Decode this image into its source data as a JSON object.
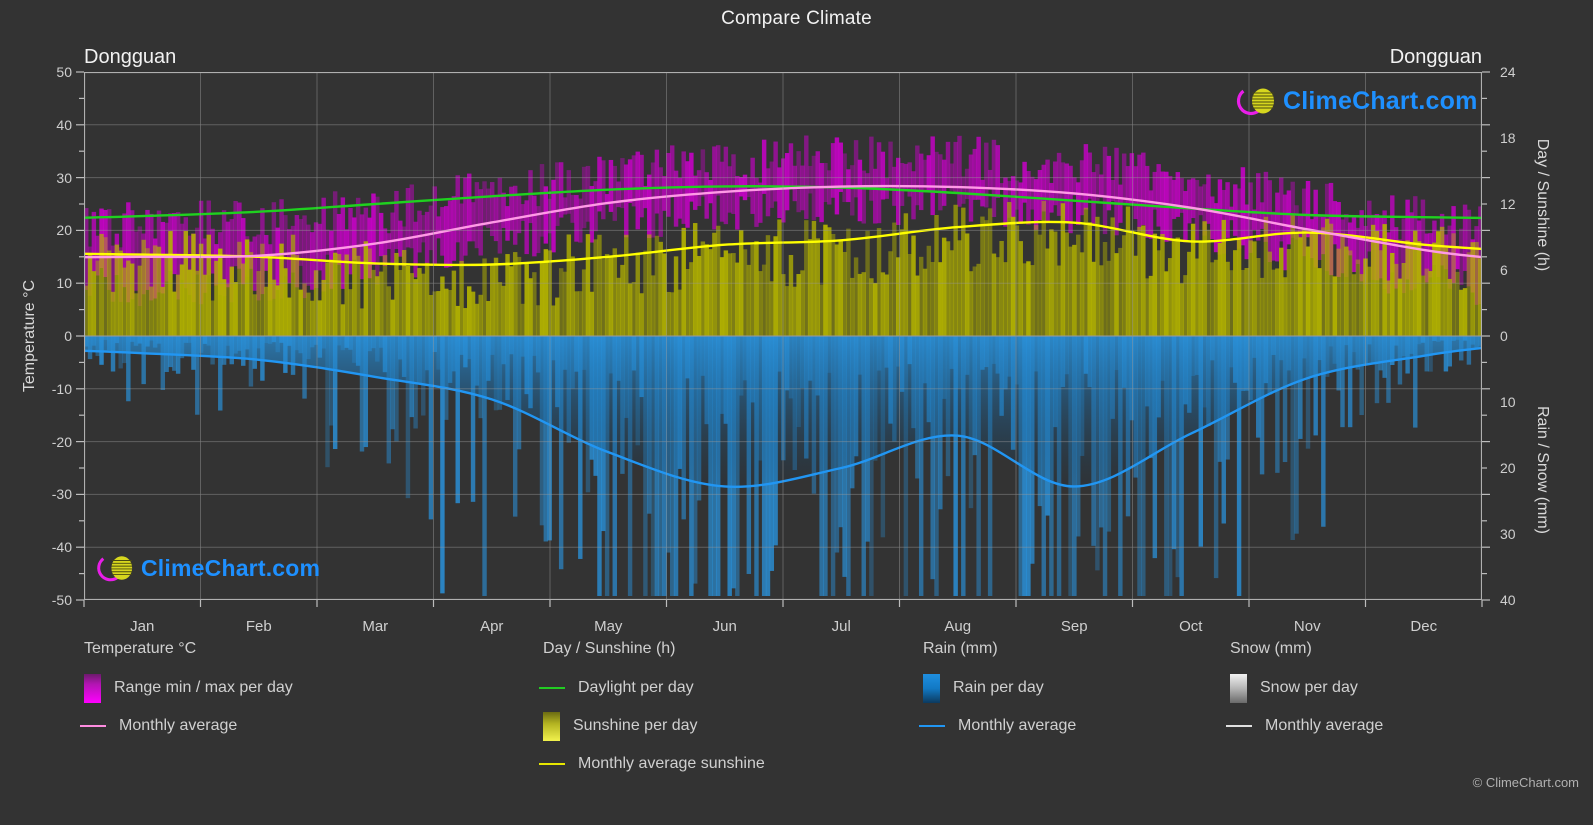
{
  "header": {
    "title": "Compare Climate",
    "location_left": "Dongguan",
    "location_right": "Dongguan"
  },
  "watermark": {
    "text": "ClimeChart.com",
    "logo_name": "climechart-logo"
  },
  "copyright": "© ClimeChart.com",
  "axes": {
    "left_title": "Temperature °C",
    "right_top_title": "Day / Sunshine (h)",
    "right_bottom_title": "Rain / Snow (mm)",
    "left_ticks": [
      "50",
      "40",
      "30",
      "20",
      "10",
      "0",
      "-10",
      "-20",
      "-30",
      "-40",
      "-50"
    ],
    "right_top_ticks": [
      "24",
      "18",
      "12",
      "6",
      "0"
    ],
    "right_bottom_ticks": [
      "0",
      "10",
      "20",
      "30",
      "40"
    ],
    "x_ticks": [
      "Jan",
      "Feb",
      "Mar",
      "Apr",
      "May",
      "Jun",
      "Jul",
      "Aug",
      "Sep",
      "Oct",
      "Nov",
      "Dec"
    ]
  },
  "legend": {
    "columns": [
      {
        "title": "Temperature °C",
        "items": [
          {
            "label": "Range min / max per day",
            "marker": "box",
            "swatch": "sw-temp",
            "icon": "temperature-range-swatch"
          },
          {
            "label": "Monthly average",
            "marker": "line",
            "swatch": "ln-temp",
            "icon": "temperature-average-line"
          }
        ]
      },
      {
        "title": "Day / Sunshine (h)",
        "items": [
          {
            "label": "Daylight per day",
            "marker": "line",
            "swatch": "ln-day",
            "icon": "daylight-line"
          },
          {
            "label": "Sunshine per day",
            "marker": "box",
            "swatch": "sw-sun",
            "icon": "sunshine-swatch"
          },
          {
            "label": "Monthly average sunshine",
            "marker": "line",
            "swatch": "ln-sunavg",
            "icon": "sunshine-average-line"
          }
        ]
      },
      {
        "title": "Rain (mm)",
        "items": [
          {
            "label": "Rain per day",
            "marker": "box",
            "swatch": "sw-rain",
            "icon": "rain-swatch"
          },
          {
            "label": "Monthly average",
            "marker": "line",
            "swatch": "ln-rain",
            "icon": "rain-average-line"
          }
        ]
      },
      {
        "title": "Snow (mm)",
        "items": [
          {
            "label": "Snow per day",
            "marker": "box",
            "swatch": "sw-snow",
            "icon": "snow-swatch"
          },
          {
            "label": "Monthly average",
            "marker": "line",
            "swatch": "ln-snow",
            "icon": "snow-average-line"
          }
        ]
      }
    ]
  },
  "colors": {
    "background": "#333333",
    "grid": "#8f8f8f",
    "temp_range_fill": "#cc00cc",
    "temp_avg_line": "#ff99e6",
    "daylight_line": "#1fd11f",
    "sunshine_fill": "#b3b300",
    "sunshine_avg_line": "#ffff00",
    "rain_fill": "#1a7fc4",
    "rain_avg_line": "#2196f3",
    "snow_fill": "#cccccc",
    "text": "#d9d9d9"
  },
  "chart_data": {
    "type": "area",
    "title": "Compare Climate",
    "subtitle": "Dongguan",
    "xlabel": "",
    "ylabel": "Temperature °C",
    "ylim": [
      -50,
      50
    ],
    "grid": true,
    "legend_position": "bottom",
    "categories": [
      "Jan",
      "Feb",
      "Mar",
      "Apr",
      "May",
      "Jun",
      "Jul",
      "Aug",
      "Sep",
      "Oct",
      "Nov",
      "Dec"
    ],
    "right_axis_top": {
      "label": "Day / Sunshine (h)",
      "range": [
        0,
        24
      ]
    },
    "right_axis_bottom": {
      "label": "Rain / Snow (mm)",
      "range": [
        0,
        40
      ]
    },
    "series": [
      {
        "name": "Monthly average temperature",
        "unit": "°C",
        "axis": "left",
        "color": "#ff99e6",
        "values": [
          15.0,
          15.2,
          17.5,
          21.5,
          25.2,
          27.3,
          28.3,
          28.2,
          27.0,
          24.3,
          20.2,
          16.3
        ]
      },
      {
        "name": "Range min per day",
        "unit": "°C",
        "axis": "left",
        "color": "#cc00cc",
        "values": [
          10.5,
          11.0,
          14.0,
          18.5,
          22.5,
          25.0,
          26.0,
          25.8,
          24.3,
          20.8,
          16.2,
          12.0
        ]
      },
      {
        "name": "Range max per day",
        "unit": "°C",
        "axis": "left",
        "color": "#cc00cc",
        "values": [
          20.0,
          20.5,
          22.5,
          26.0,
          29.5,
          31.5,
          33.0,
          32.5,
          31.5,
          28.5,
          25.0,
          21.0
        ]
      },
      {
        "name": "Daylight per day",
        "unit": "h",
        "axis": "right_top",
        "color": "#1fd11f",
        "values": [
          10.9,
          11.3,
          12.0,
          12.7,
          13.3,
          13.6,
          13.5,
          13.0,
          12.3,
          11.6,
          11.0,
          10.8
        ]
      },
      {
        "name": "Monthly average sunshine",
        "unit": "h",
        "axis": "right_top",
        "color": "#ffff00",
        "values": [
          7.4,
          7.2,
          6.6,
          6.5,
          7.2,
          8.3,
          8.7,
          9.9,
          10.3,
          8.6,
          9.4,
          8.3
        ]
      },
      {
        "name": "Monthly average rain",
        "unit": "mm",
        "axis": "right_bottom",
        "color": "#2196f3",
        "values": [
          2.6,
          3.6,
          6.2,
          9.6,
          17.6,
          22.8,
          20.0,
          15.1,
          22.8,
          14.8,
          6.4,
          3.0
        ]
      }
    ]
  }
}
